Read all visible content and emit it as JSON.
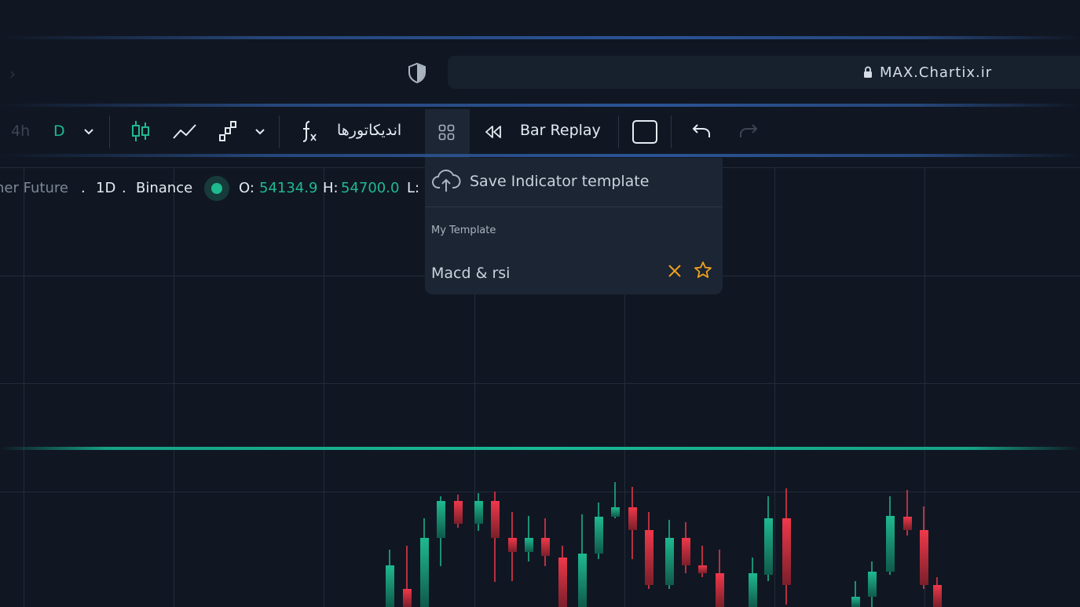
{
  "browser": {
    "url": "MAX.Chartix.ir",
    "nav_back_glyph": "›",
    "icons": [
      "shield-icon",
      "lock-icon"
    ]
  },
  "toolbar": {
    "interval_faded": "4h",
    "interval_active": "D",
    "indicators_label": "اندیکاتورها",
    "bar_replay_label": "Bar Replay",
    "colors": {
      "active_interval": "#1fb98f",
      "text": "#e6ebf2",
      "disabled": "#3b4554"
    }
  },
  "symbol_info": {
    "name": "her Future",
    "sep1": ".",
    "timeframe": "1D",
    "sep2": ".",
    "exchange": "Binance",
    "open_label": "O:",
    "open_value": "54134.9",
    "high_label": "H:",
    "high_value": "54700.0",
    "low_label": "L:",
    "value_color": "#1fb98f"
  },
  "template_dropdown": {
    "save_label": "Save Indicator template",
    "section_label": "My Template",
    "items": [
      {
        "name": "Macd & rsi"
      }
    ],
    "accent_color": "#f0a020"
  },
  "candles": [
    {
      "o": 0.0,
      "c": 0.0,
      "h": 0.0,
      "l": 0.0
    }
  ]
}
